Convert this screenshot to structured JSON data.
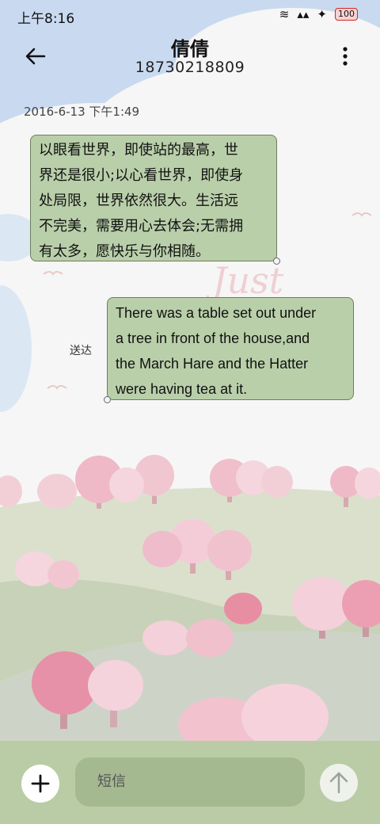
{
  "status_bar": {
    "time": "上午8:16",
    "icons": [
      "alarm-icon",
      "vibrate-icon",
      "signal-icon",
      "wifi-icon",
      "battery-icon"
    ],
    "battery": "100"
  },
  "header": {
    "title": "倩倩",
    "subtitle": "18730218809",
    "back_icon": "arrow-left-icon",
    "more_icon": "more-vertical-icon"
  },
  "conversation": {
    "date": "2016-6-13 下午1:49",
    "messages": [
      {
        "direction": "incoming",
        "lines": [
          "以眼看世界，即使站的最高，世",
          "界还是很小;以心看世界，即使身",
          "处局限，世界依然很大。生活远",
          "不完美，需要用心去体会;无需拥",
          "有太多，愿快乐与你相随。"
        ]
      },
      {
        "direction": "outgoing",
        "lines": [
          "There was a table set out under",
          "a tree in front of the house,and",
          "the March Hare and the Hatter",
          "were having tea at it."
        ],
        "status": "送达"
      }
    ]
  },
  "input_bar": {
    "placeholder": "短信",
    "add_icon": "plus-icon",
    "send_icon": "arrow-up-icon"
  },
  "colors": {
    "bubble": "#b9cfaa",
    "bubble_border": "#6c7f5e",
    "input_bar": "#b9cca6",
    "sky": "#c9daf0"
  }
}
